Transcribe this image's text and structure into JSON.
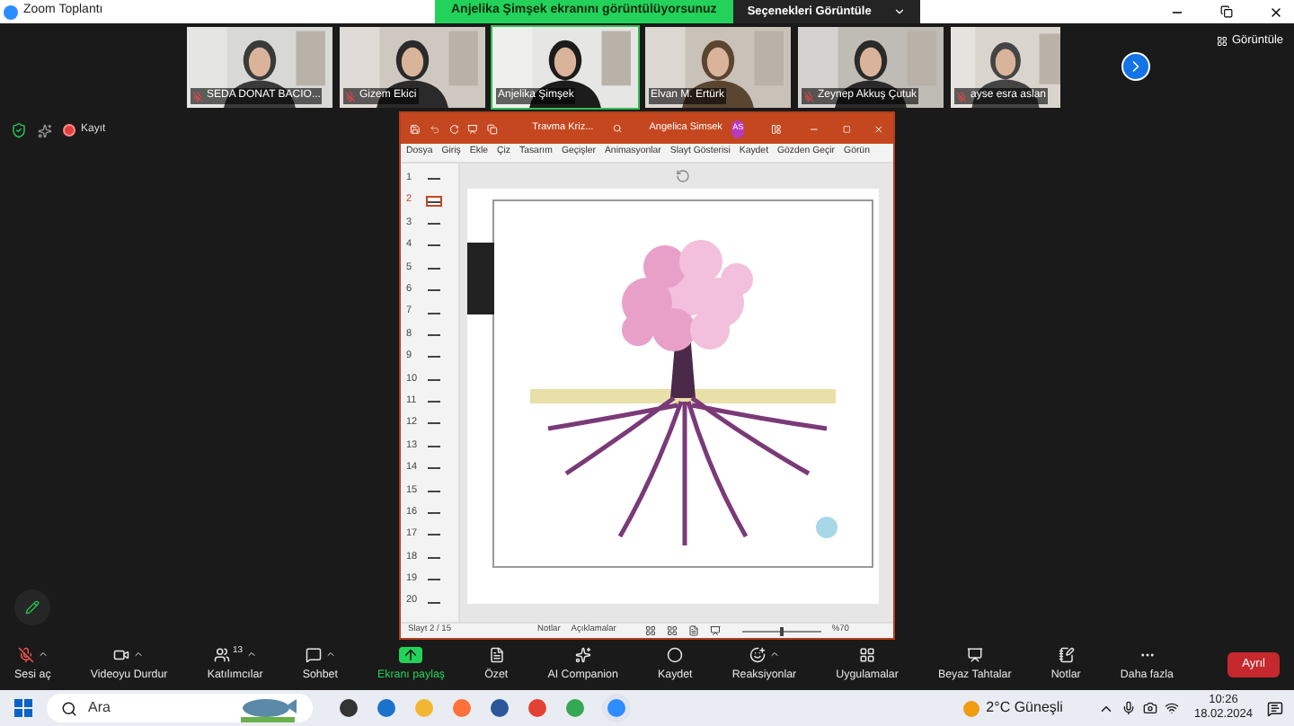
{
  "window": {
    "title": "Zoom Toplantı",
    "share_banner": "Anjelika Şimşek ekranını görüntülüyorsunuz",
    "options_button": "Seçenekleri Görüntüle"
  },
  "participants": [
    {
      "name": "SEDA DONAT BACIO...",
      "muted": true,
      "selected": false
    },
    {
      "name": "Gizem Ekici",
      "muted": true,
      "selected": false
    },
    {
      "name": "Anjelika Şimşek",
      "muted": false,
      "selected": true
    },
    {
      "name": "Elvan M. Ertürk",
      "muted": false,
      "selected": false
    },
    {
      "name": "Zeynep Akkuş Çutuk",
      "muted": true,
      "selected": false
    },
    {
      "name": "ayse esra aslan",
      "muted": true,
      "selected": false
    }
  ],
  "view_button": "Görüntüle",
  "recording": {
    "label": "Kayıt"
  },
  "powerpoint": {
    "file_title": "Travma Kriz...",
    "user": "Angelica Simsek",
    "avatar": "AS",
    "ribbon_tabs": [
      "Dosya",
      "Giriş",
      "Ekle",
      "Çiz",
      "Tasarım",
      "Geçişler",
      "Animasyonlar",
      "Slayt Gösterisi",
      "Kaydet",
      "Gözden Geçir",
      "Görün"
    ],
    "slides": [
      {
        "number": "1",
        "selected": false
      },
      {
        "number": "2",
        "selected": true
      },
      {
        "number": "3",
        "selected": false
      },
      {
        "number": "4",
        "selected": false
      },
      {
        "number": "5",
        "selected": false
      },
      {
        "number": "6",
        "selected": false
      },
      {
        "number": "7",
        "selected": false
      },
      {
        "number": "8",
        "selected": false
      },
      {
        "number": "9",
        "selected": false
      },
      {
        "number": "10",
        "selected": false
      },
      {
        "number": "11",
        "selected": false
      },
      {
        "number": "12",
        "selected": false
      },
      {
        "number": "13",
        "selected": false
      },
      {
        "number": "14",
        "selected": false
      },
      {
        "number": "15",
        "selected": false
      },
      {
        "number": "16",
        "selected": false
      },
      {
        "number": "17",
        "selected": false
      },
      {
        "number": "18",
        "selected": false
      },
      {
        "number": "19",
        "selected": false
      },
      {
        "number": "20",
        "selected": false
      }
    ],
    "status": {
      "slide_count": "Slayt 2 / 15",
      "notes": "Notlar",
      "comments": "Açıklamalar",
      "zoom": "%70",
      "level": 0.5
    }
  },
  "toolbar": [
    {
      "label": "Sesi aç",
      "has_menu": true
    },
    {
      "label": "Videoyu Durdur",
      "has_menu": true
    },
    {
      "label": "Katılımcılar",
      "count": "13",
      "has_menu": true
    },
    {
      "label": "Sohbet",
      "has_menu": true
    },
    {
      "label": "Ekranı paylaş",
      "has_menu": false
    },
    {
      "label": "Özet",
      "has_menu": false
    },
    {
      "label": "AI Companion",
      "has_menu": false
    },
    {
      "label": "Kaydet",
      "has_menu": false
    },
    {
      "label": "Reaksiyonlar",
      "has_menu": true
    },
    {
      "label": "Uygulamalar",
      "has_menu": false
    },
    {
      "label": "Beyaz Tahtalar",
      "has_menu": false
    },
    {
      "label": "Notlar",
      "has_menu": false
    },
    {
      "label": "Daha fazla",
      "has_menu": false
    }
  ],
  "leave_button": "Ayrıl",
  "taskbar": {
    "search_placeholder": "Ara",
    "weather": "2°C Güneşli",
    "time": "10:26",
    "date": "18.02.2024"
  }
}
